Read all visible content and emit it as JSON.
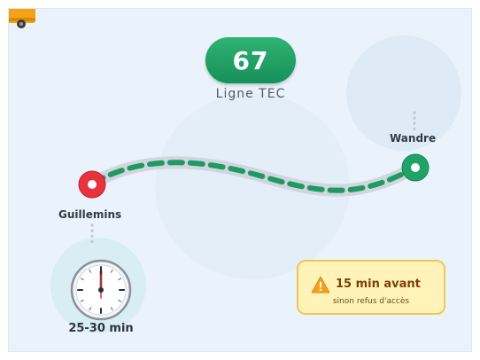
{
  "line": {
    "number": "67",
    "label": "Ligne TEC"
  },
  "stops": {
    "start": "Guillemins",
    "end": "Wandre"
  },
  "duration": "25-30 min",
  "warning": {
    "title": "15 min avant",
    "subtitle": "sinon refus d'accès"
  },
  "colors": {
    "line_green": "#1fa366",
    "route_dash": "#1f9a63",
    "start_stop": "#e8323e",
    "end_stop": "#1fa366",
    "warning_bg": "#fff3b8",
    "warning_border": "#f2c558",
    "warning_text": "#7a3f0a"
  },
  "icons": [
    "bus-icon",
    "clock-icon",
    "warning-icon",
    "start-stop-icon",
    "end-stop-icon"
  ]
}
